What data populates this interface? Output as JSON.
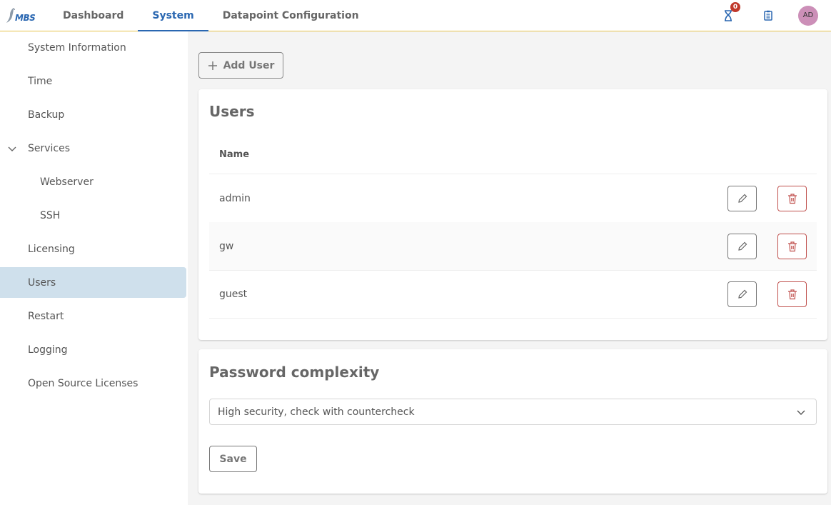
{
  "header": {
    "logo_text": "MBS",
    "tabs": [
      {
        "label": "Dashboard",
        "active": false
      },
      {
        "label": "System",
        "active": true
      },
      {
        "label": "Datapoint Configuration",
        "active": false
      }
    ],
    "badge_count": "0",
    "avatar_initials": "AD"
  },
  "sidebar": {
    "items": [
      {
        "label": "System Information"
      },
      {
        "label": "Time"
      },
      {
        "label": "Backup"
      },
      {
        "label": "Services"
      },
      {
        "label": "Webserver"
      },
      {
        "label": "SSH"
      },
      {
        "label": "Licensing"
      },
      {
        "label": "Users"
      },
      {
        "label": "Restart"
      },
      {
        "label": "Logging"
      },
      {
        "label": "Open Source Licenses"
      }
    ]
  },
  "main": {
    "add_user_label": "Add User",
    "users_title": "Users",
    "name_header": "Name",
    "users": [
      {
        "name": "admin"
      },
      {
        "name": "gw"
      },
      {
        "name": "guest"
      }
    ],
    "password_title": "Password complexity",
    "password_selected": "High security, check with countercheck",
    "save_label": "Save"
  },
  "colors": {
    "accent": "#2a67b1",
    "header_border": "#e6c24c",
    "active_nav_bg": "#cfe0ec",
    "delete": "#c0504d",
    "badge": "#c0392b",
    "avatar": "#cc8fb8"
  }
}
